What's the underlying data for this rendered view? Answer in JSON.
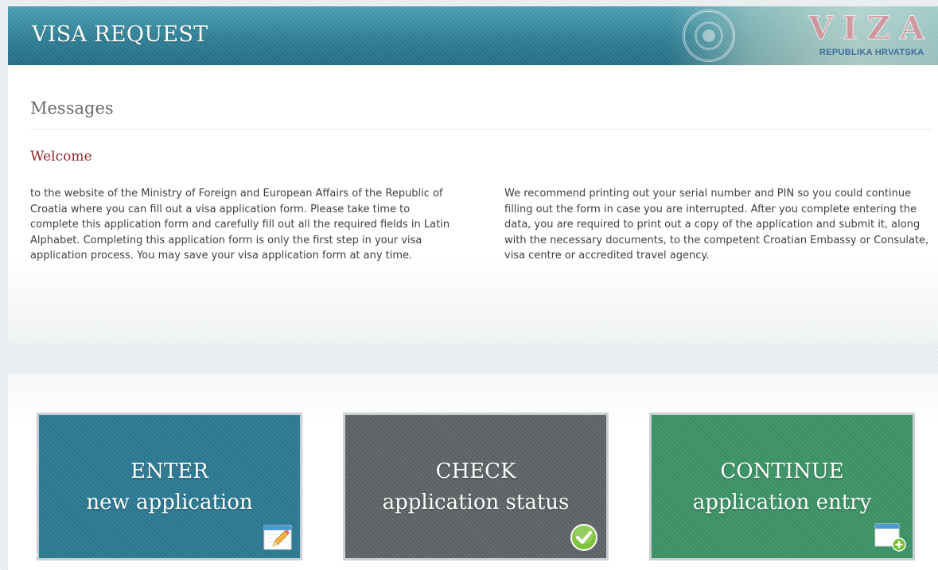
{
  "header": {
    "title": "VISA REQUEST",
    "visa_word": "VIZA",
    "visa_country": "REPUBLIKA HRVATSKA"
  },
  "messages": {
    "title": "Messages",
    "welcome_heading": "Welcome",
    "paragraph_left": "to the website of the Ministry of Foreign and European Affairs of the Republic of Croatia where you can fill out a visa application form. Please take time to complete this application form and carefully fill out all the required fields in Latin Alphabet. Completing this application form is only the first step in your visa application process. You may save your visa application form at any time.",
    "paragraph_right": "We recommend printing out your serial number and PIN so you could continue filling out the form in case you are interrupted. After you complete entering the data, you are required to print out a copy of the application and submit it, along with the necessary documents, to the competent Croatian Embassy or Consulate, visa centre or accredited travel agency."
  },
  "actions": [
    {
      "line1": "ENTER",
      "line2": "new application",
      "icon": "edit-icon",
      "color": "#2c7a93"
    },
    {
      "line1": "CHECK",
      "line2": "application status",
      "icon": "check-icon",
      "color": "#5f6466"
    },
    {
      "line1": "CONTINUE",
      "line2": "application entry",
      "icon": "add-window-icon",
      "color": "#3c9466"
    }
  ],
  "colors": {
    "header": "#2e7f96",
    "welcome": "#8c2a2a"
  }
}
